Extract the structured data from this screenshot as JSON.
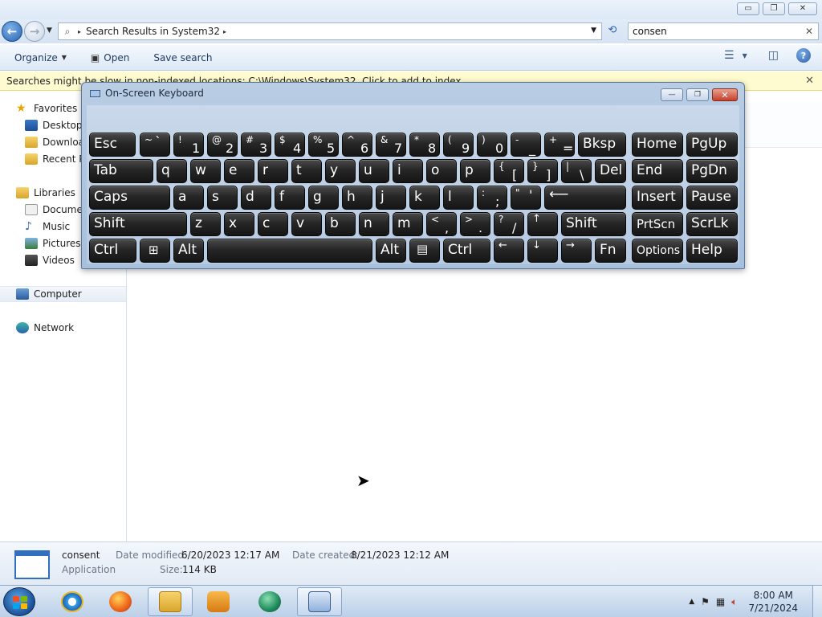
{
  "explorer": {
    "caption_buttons": {
      "minimize": "▭",
      "restore": "❐",
      "close": "✕"
    },
    "address": {
      "breadcrumb": "Search Results in System32",
      "separator": "▸"
    },
    "search": {
      "value": "consen",
      "clear": "✕"
    },
    "toolbar": {
      "organize": "Organize",
      "open": "Open",
      "save_search": "Save search"
    },
    "info_bar": "Searches might be slow in non-indexed locations: C:\\Windows\\System32. Click to add to index...",
    "nav": {
      "favorites": "Favorites",
      "desktop": "Desktop",
      "downloads": "Downloads",
      "recent_places": "Recent Places",
      "libraries": "Libraries",
      "documents": "Documents",
      "music": "Music",
      "pictures": "Pictures",
      "videos": "Videos",
      "computer": "Computer",
      "network": "Network"
    },
    "details": {
      "name": "consent",
      "type": "Application",
      "date_modified_label": "Date modified:",
      "date_modified": "6/20/2023 12:17 AM",
      "date_created_label": "Date created:",
      "date_created": "8/21/2023 12:12 AM",
      "size_label": "Size:",
      "size": "114 KB"
    }
  },
  "osk": {
    "title": "On-Screen Keyboard",
    "caption_buttons": {
      "minimize": "—",
      "restore": "❐",
      "close": "✕"
    },
    "keys": {
      "esc": "Esc",
      "tilde_top": "~",
      "tilde_bot": "`",
      "n1_top": "!",
      "n1": "1",
      "n2_top": "@",
      "n2": "2",
      "n3_top": "#",
      "n3": "3",
      "n4_top": "$",
      "n4": "4",
      "n5_top": "%",
      "n5": "5",
      "n6_top": "^",
      "n6": "6",
      "n7_top": "&",
      "n7": "7",
      "n8_top": "*",
      "n8": "8",
      "n9_top": "(",
      "n9": "9",
      "n0_top": ")",
      "n0": "0",
      "minus_top": "-",
      "minus": "_",
      "plus_top": "+",
      "plus": "=",
      "bksp": "Bksp",
      "home": "Home",
      "pgup": "PgUp",
      "tab": "Tab",
      "q": "q",
      "w": "w",
      "e": "e",
      "r": "r",
      "t": "t",
      "y": "y",
      "u": "u",
      "i": "i",
      "o": "o",
      "p": "p",
      "lbr_top": "{",
      "lbr": "[",
      "rbr_top": "}",
      "rbr": "]",
      "bs_top": "|",
      "bs": "\\",
      "del": "Del",
      "end": "End",
      "pgdn": "PgDn",
      "caps": "Caps",
      "a": "a",
      "s": "s",
      "d": "d",
      "f": "f",
      "g": "g",
      "h": "h",
      "j": "j",
      "k": "k",
      "l": "l",
      "semi_top": ":",
      "semi": ";",
      "quote_top": "\"",
      "quote": "'",
      "enter": "⟵",
      "insert": "Insert",
      "pause": "Pause",
      "lshift": "Shift",
      "z": "z",
      "x": "x",
      "c": "c",
      "v": "v",
      "b": "b",
      "n": "n",
      "m": "m",
      "comma_top": "<",
      "comma": ",",
      "period_top": ">",
      "period": ".",
      "slash_top": "?",
      "slash": "/",
      "up": "↑",
      "rshift": "Shift",
      "prtscn": "PrtScn",
      "scrlk": "ScrLk",
      "lctrl": "Ctrl",
      "win": "⊞",
      "lalt": "Alt",
      "ralt": "Alt",
      "menu": "▤",
      "rctrl": "Ctrl",
      "left": "←",
      "down": "↓",
      "right": "→",
      "fn": "Fn",
      "options": "Options",
      "help": "Help"
    }
  },
  "taskbar": {
    "clock_time": "8:00 AM",
    "clock_date": "7/21/2024"
  }
}
